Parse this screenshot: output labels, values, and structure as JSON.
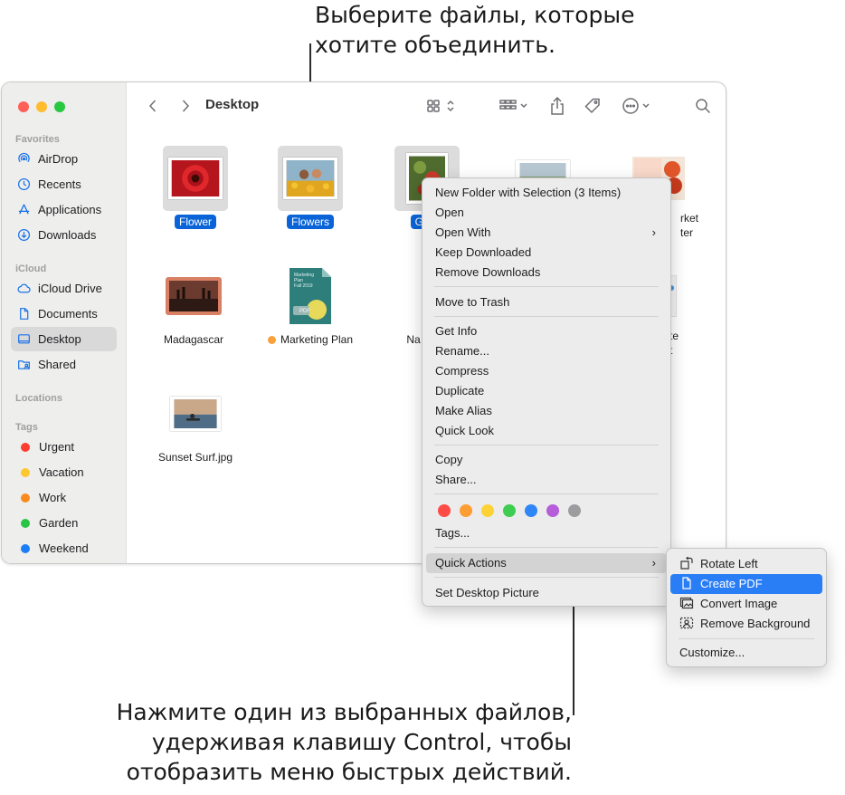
{
  "callouts": {
    "top_line1": "Выберите файлы, которые",
    "top_line2": "хотите объединить.",
    "bottom_line1": "Нажмите один из выбранных файлов,",
    "bottom_line2": "удерживая клавишу Control, чтобы",
    "bottom_line3": "отобразить меню быстрых действий."
  },
  "window": {
    "title": "Desktop",
    "icons": [
      "back-icon",
      "forward-icon",
      "grid-view-icon",
      "group-icon",
      "share-icon",
      "tag-icon",
      "more-icon",
      "search-icon"
    ]
  },
  "sidebar": {
    "favorites_header": "Favorites",
    "favorites": [
      {
        "label": "AirDrop",
        "icon": "airdrop-icon"
      },
      {
        "label": "Recents",
        "icon": "clock-icon"
      },
      {
        "label": "Applications",
        "icon": "applications-icon"
      },
      {
        "label": "Downloads",
        "icon": "downloads-icon"
      }
    ],
    "icloud_header": "iCloud",
    "icloud": [
      {
        "label": "iCloud Drive",
        "icon": "cloud-icon"
      },
      {
        "label": "Documents",
        "icon": "document-icon"
      },
      {
        "label": "Desktop",
        "icon": "desktop-icon",
        "selected": true
      },
      {
        "label": "Shared",
        "icon": "shared-folder-icon"
      }
    ],
    "locations_header": "Locations",
    "tags_header": "Tags",
    "tags": [
      {
        "label": "Urgent",
        "color": "#fe3b30"
      },
      {
        "label": "Vacation",
        "color": "#fdc82f"
      },
      {
        "label": "Work",
        "color": "#f98b1e"
      },
      {
        "label": "Garden",
        "color": "#29c446"
      },
      {
        "label": "Weekend",
        "color": "#1b7ef7"
      }
    ]
  },
  "files": [
    {
      "name": "Flower",
      "selected": true
    },
    {
      "name": "Flowers",
      "selected": true
    },
    {
      "name": "Gard",
      "selected": true
    },
    {
      "name": "rket",
      "name2": "ter",
      "selected": false
    },
    {
      "name": "Madagascar",
      "selected": false
    },
    {
      "name": "Marketing Plan",
      "tag_color": "#f9a13a",
      "selected": false
    },
    {
      "name": "Na",
      "selected": false
    },
    {
      "name": "te",
      "name2": "t",
      "selected": false
    },
    {
      "name": "Sunset Surf.jpg",
      "selected": false
    }
  ],
  "marketing_thumb": {
    "line1": "Marketing",
    "line2": "Plan",
    "line3": "Fall 2019",
    "badge": "PDF"
  },
  "context_menu": {
    "new_folder": "New Folder with Selection (3 Items)",
    "open": "Open",
    "open_with": "Open With",
    "keep_downloaded": "Keep Downloaded",
    "remove_downloads": "Remove Downloads",
    "move_to_trash": "Move to Trash",
    "get_info": "Get Info",
    "rename": "Rename...",
    "compress": "Compress",
    "duplicate": "Duplicate",
    "make_alias": "Make Alias",
    "quick_look": "Quick Look",
    "copy": "Copy",
    "share": "Share...",
    "tag_colors": [
      "#fe4b45",
      "#fd9d33",
      "#fdd235",
      "#3ecd51",
      "#2f86f6",
      "#b65dd9",
      "#9d9da0"
    ],
    "tags": "Tags...",
    "quick_actions": "Quick Actions",
    "set_desktop_picture": "Set Desktop Picture",
    "submenu_arrow": "›"
  },
  "quick_actions_menu": {
    "rotate_left": "Rotate Left",
    "create_pdf": "Create PDF",
    "convert_image": "Convert Image",
    "remove_background": "Remove Background",
    "customize": "Customize..."
  }
}
